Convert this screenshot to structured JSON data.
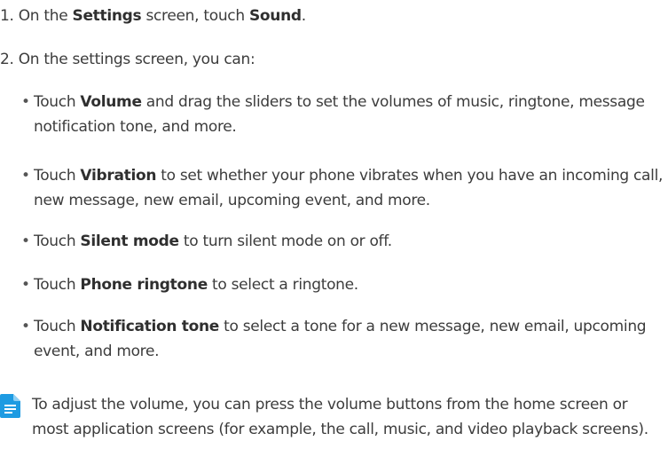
{
  "steps": {
    "step1": {
      "prefix": "1. On the ",
      "settings": "Settings",
      "middle": " screen, touch ",
      "sound": "Sound",
      "suffix": "."
    },
    "step2": {
      "text": "2.  On the settings screen, you can:"
    }
  },
  "bullets": [
    {
      "marker": "•",
      "pre": "Touch ",
      "term": "Volume",
      "rest": " and drag the sliders to set the volumes of music, ringtone, message notification tone, and more."
    },
    {
      "marker": "•",
      "pre": "Touch ",
      "term": "Vibration",
      "rest": " to set whether your phone vibrates when you have an incoming call, new message, new email, upcoming event, and more."
    },
    {
      "marker": "•",
      "pre": "Touch ",
      "term": "Silent mode",
      "rest": " to turn silent mode on or off."
    },
    {
      "marker": "•",
      "pre": "Touch ",
      "term": "Phone ringtone",
      "rest": " to select a ringtone."
    },
    {
      "marker": "•",
      "pre": "Touch ",
      "term": "Notification tone",
      "rest": " to select a tone for a new message, new email, upcoming event, and more."
    }
  ],
  "note": {
    "icon": "note-icon",
    "icon_color": "#1e9be2",
    "text": "To adjust the volume, you can press the volume buttons from the home screen or most application screens (for example, the call, music, and video playback screens)."
  }
}
